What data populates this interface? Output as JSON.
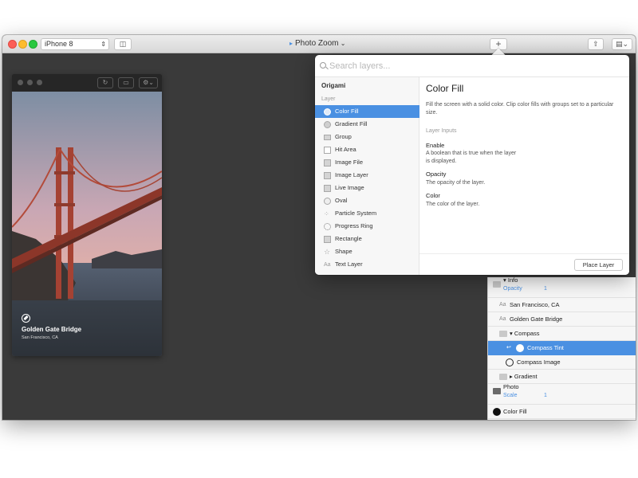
{
  "window": {
    "device_select": "iPhone 8",
    "document_title": "Photo Zoom",
    "add_button": "+"
  },
  "viewer": {
    "photo_title": "Golden Gate Bridge",
    "photo_subtitle": "San Francisco, CA"
  },
  "popover": {
    "search_placeholder": "Search layers...",
    "group_title": "Origami",
    "group_subtitle": "Layer",
    "items": [
      {
        "label": "Color Fill",
        "icon": "circle-icon"
      },
      {
        "label": "Gradient Fill",
        "icon": "circle-icon"
      },
      {
        "label": "Group",
        "icon": "folder-icon"
      },
      {
        "label": "Hit Area",
        "icon": "hit-area-icon"
      },
      {
        "label": "Image File",
        "icon": "image-icon"
      },
      {
        "label": "Image Layer",
        "icon": "image-icon"
      },
      {
        "label": "Live Image",
        "icon": "image-icon"
      },
      {
        "label": "Oval",
        "icon": "circle-icon"
      },
      {
        "label": "Particle System",
        "icon": "particle-icon"
      },
      {
        "label": "Progress Ring",
        "icon": "ring-icon"
      },
      {
        "label": "Rectangle",
        "icon": "rectangle-icon"
      },
      {
        "label": "Shape",
        "icon": "star-icon"
      },
      {
        "label": "Text Layer",
        "icon": "text-icon"
      }
    ],
    "detail": {
      "title": "Color Fill",
      "description": "Fill the screen with a solid color. Clip color fills with groups set to a particular size.",
      "section": "Layer Inputs",
      "inputs": [
        {
          "name": "Enable",
          "desc": "A boolean that is true when the layer is displayed."
        },
        {
          "name": "Opacity",
          "desc": "The opacity of the layer."
        },
        {
          "name": "Color",
          "desc": "The color of the layer."
        }
      ],
      "place_button": "Place Layer"
    }
  },
  "layers": {
    "rows": [
      {
        "label": "Info",
        "sub_label": "Opacity",
        "sub_value": "1"
      },
      {
        "label": "San Francisco, CA"
      },
      {
        "label": "Golden Gate Bridge"
      },
      {
        "label": "Compass"
      },
      {
        "label": "Compass Tint"
      },
      {
        "label": "Compass Image"
      },
      {
        "label": "Gradient"
      },
      {
        "label": "Photo",
        "sub_label": "Scale",
        "sub_value": "1"
      },
      {
        "label": "Color Fill"
      }
    ]
  },
  "colors": {
    "accent": "#4a90e2",
    "canvas": "#3a3a3a"
  }
}
